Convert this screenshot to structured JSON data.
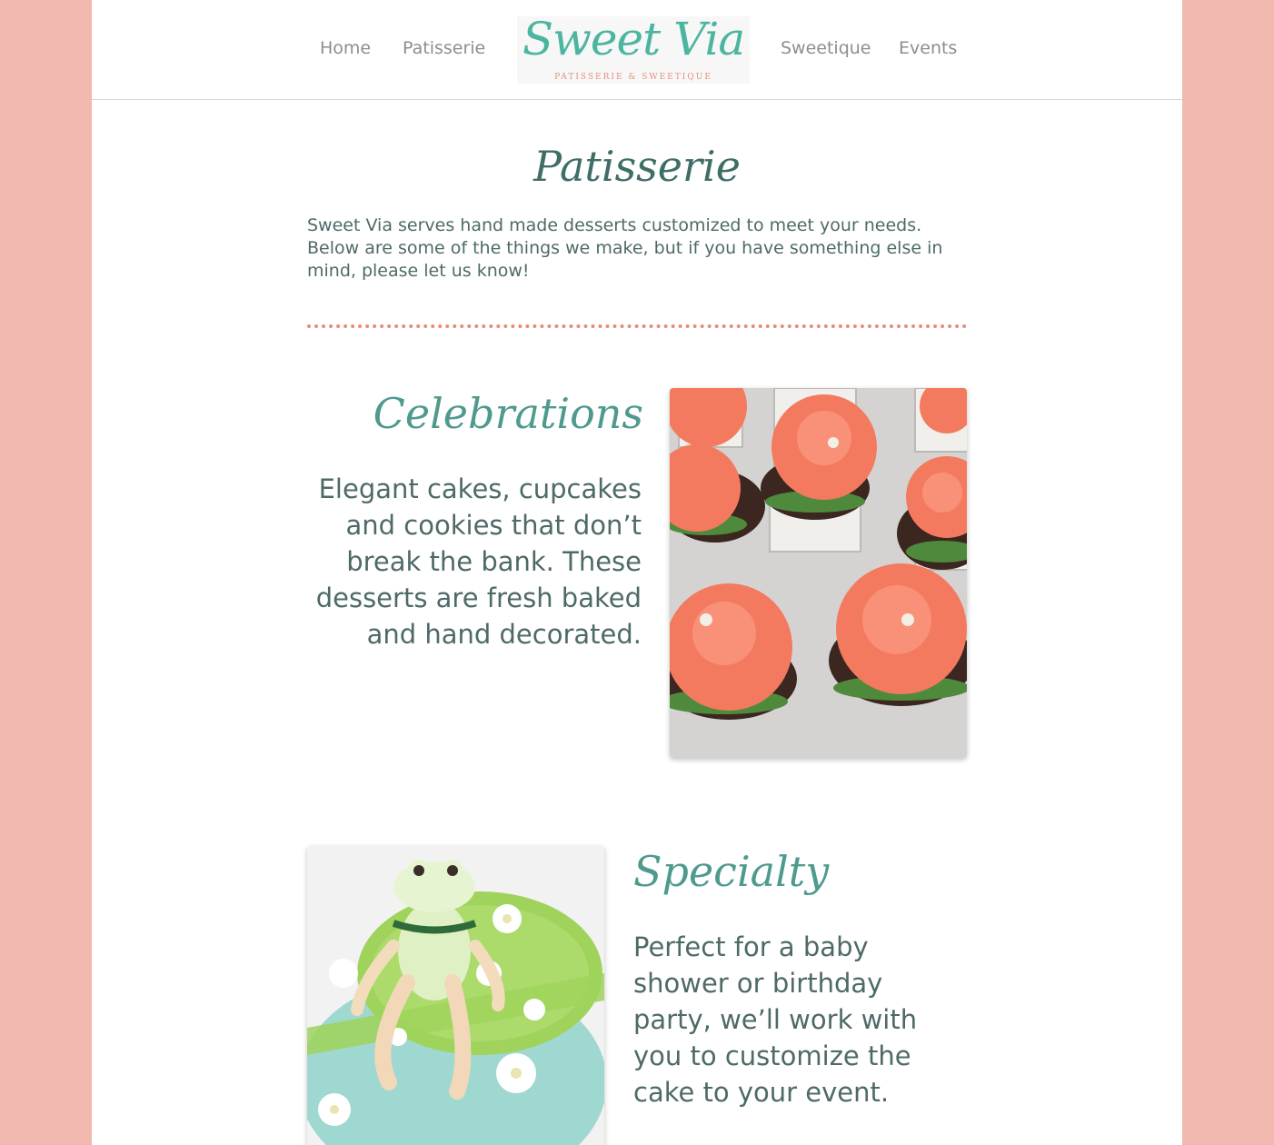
{
  "nav": {
    "home": "Home",
    "patisserie": "Patisserie",
    "sweetique": "Sweetique",
    "events": "Events"
  },
  "logo": {
    "name": "Sweet Via",
    "tagline": "PATISSERIE & SWEETIQUE"
  },
  "main": {
    "heading": "Patisserie",
    "intro": "Sweet Via serves hand made desserts customized to meet your needs. Below are some of the things we make, but if you have something else in mind, please let us know!"
  },
  "sections": [
    {
      "title": "Celebrations",
      "text": "Elegant cakes, cupcakes and cookies that don’t break the bank. These desserts are fresh baked and hand decorated."
    },
    {
      "title": "Specialty",
      "text": "Perfect for a baby shower or birthday party, we’ll work with you to customize the cake to your event."
    }
  ],
  "colors": {
    "background": "#f0b8af",
    "accent_teal": "#4cb5a0",
    "heading_teal": "#4f9a8e",
    "body_text": "#4e6a68",
    "dots_coral": "#e98a7e",
    "nav_text": "#8a8f8e"
  }
}
